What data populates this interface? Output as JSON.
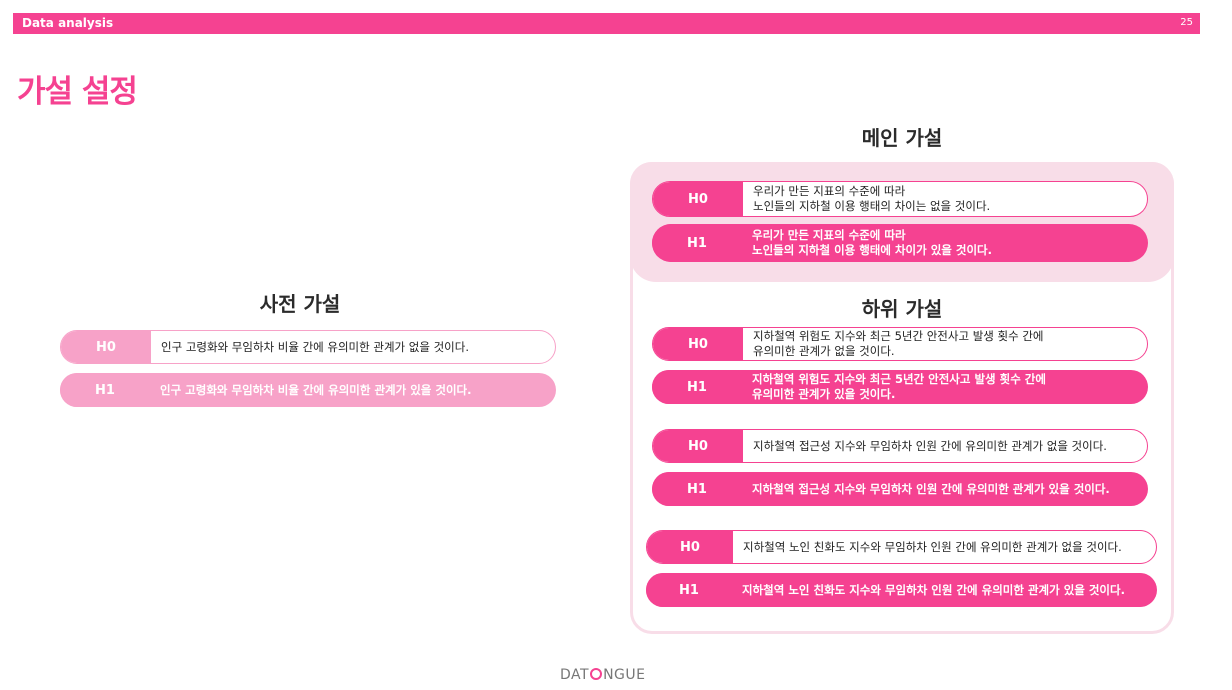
{
  "header": {
    "label": "Data analysis",
    "page": "25"
  },
  "title": "가설 설정",
  "prior": {
    "title": "사전 가설",
    "h0": {
      "tag": "H0",
      "text": "인구 고령화와 무임하차 비율 간에 유의미한 관계가 없을 것이다."
    },
    "h1": {
      "tag": "H1",
      "text": "인구 고령화와 무임하차 비율 간에 유의미한 관계가 있을 것이다."
    }
  },
  "main": {
    "title": "메인 가설",
    "h0": {
      "tag": "H0",
      "text": "우리가 만든 지표의 수준에 따라\n노인들의 지하철 이용 행태의 차이는 없을 것이다."
    },
    "h1": {
      "tag": "H1",
      "text": "우리가 만든 지표의 수준에 따라\n노인들의 지하철 이용 행태에 차이가 있을 것이다."
    }
  },
  "sub": {
    "title": "하위 가설",
    "groups": [
      {
        "h0": {
          "tag": "H0",
          "text": "지하철역 위험도 지수와 최근 5년간 안전사고 발생 횟수 간에\n유의미한 관계가 없을 것이다."
        },
        "h1": {
          "tag": "H1",
          "text": "지하철역 위험도 지수와 최근 5년간 안전사고 발생 횟수 간에\n유의미한 관계가 있을 것이다."
        }
      },
      {
        "h0": {
          "tag": "H0",
          "text": "지하철역 접근성 지수와 무임하차 인원 간에 유의미한 관계가 없을 것이다."
        },
        "h1": {
          "tag": "H1",
          "text": "지하철역 접근성 지수와 무임하차 인원 간에 유의미한 관계가 있을 것이다."
        }
      },
      {
        "h0": {
          "tag": "H0",
          "text": "지하철역 노인 친화도 지수와 무임하차 인원 간에 유의미한 관계가 없을 것이다."
        },
        "h1": {
          "tag": "H1",
          "text": "지하철역 노인 친화도 지수와 무임하차 인원 간에 유의미한 관계가 있을 것이다."
        }
      }
    ]
  },
  "logo": {
    "left": "DAT",
    "right": "NGUE"
  },
  "colors": {
    "accent": "#f54291",
    "light": "#f7a2c8",
    "panel": "#f8dde8"
  }
}
